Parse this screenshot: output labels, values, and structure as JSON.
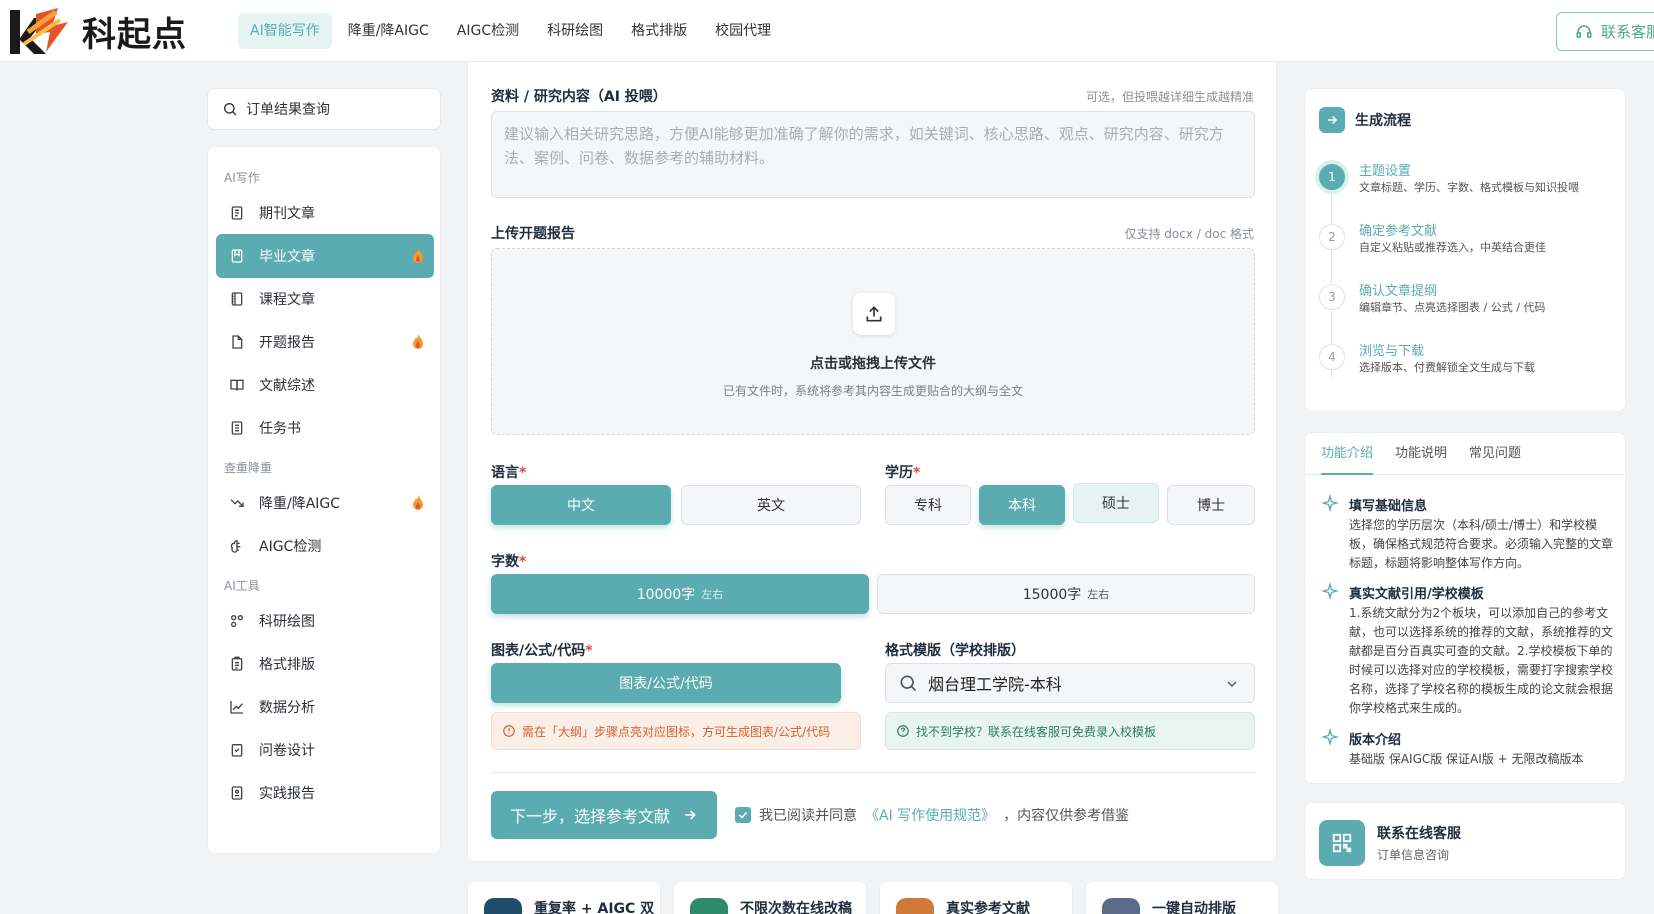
{
  "brand": {
    "name": "科起点"
  },
  "nav": {
    "items": [
      {
        "label": "AI智能写作",
        "active": true
      },
      {
        "label": "降重/降AIGC"
      },
      {
        "label": "AIGC检测"
      },
      {
        "label": "科研绘图"
      },
      {
        "label": "格式排版"
      },
      {
        "label": "校园代理"
      }
    ],
    "contact_label": "联系客服"
  },
  "search": {
    "label": "订单结果查询"
  },
  "sidebar": {
    "groups": [
      {
        "title": "AI写作"
      },
      {
        "title": "查重降重"
      },
      {
        "title": "AI工具"
      }
    ],
    "items": [
      {
        "label": "期刊文章",
        "icon": "document-icon"
      },
      {
        "label": "毕业文章",
        "icon": "book-icon",
        "active": true,
        "hot": true
      },
      {
        "label": "课程文章",
        "icon": "notebook-icon"
      },
      {
        "label": "开题报告",
        "icon": "file-icon",
        "hot": true
      },
      {
        "label": "文献综述",
        "icon": "open-book-icon"
      },
      {
        "label": "任务书",
        "icon": "list-icon"
      },
      {
        "label": "降重/降AIGC",
        "icon": "trend-down-icon",
        "hot": true
      },
      {
        "label": "AIGC检测",
        "icon": "brain-icon"
      },
      {
        "label": "科研绘图",
        "icon": "shapes-icon"
      },
      {
        "label": "格式排版",
        "icon": "clipboard-icon"
      },
      {
        "label": "数据分析",
        "icon": "chart-icon"
      },
      {
        "label": "问卷设计",
        "icon": "checklist-icon"
      },
      {
        "label": "实践报告",
        "icon": "report-icon"
      }
    ]
  },
  "form": {
    "material": {
      "label": "资料 / 研究内容（AI 投喂）",
      "hint": "可选，但投喂越详细生成越精准",
      "placeholder": "建议输入相关研究思路，方便AI能够更加准确了解你的需求，如关键词、核心思路、观点、研究内容、研究方法、案例、问卷、数据参考的辅助材料。"
    },
    "upload": {
      "label": "上传开题报告",
      "hint": "仅支持 docx / doc 格式",
      "title": "点击或拖拽上传文件",
      "sub": "已有文件时，系统将参考其内容生成更贴合的大纲与全文"
    },
    "language": {
      "label": "语言",
      "options": [
        "中文",
        "英文"
      ],
      "selected": "中文"
    },
    "degree": {
      "label": "学历",
      "options": [
        "专科",
        "本科",
        "硕士",
        "博士"
      ],
      "selected": "本科"
    },
    "words": {
      "label": "字数",
      "options": [
        {
          "value": "10000字",
          "note": "左右"
        },
        {
          "value": "15000字",
          "note": "左右"
        }
      ],
      "selected": "10000字"
    },
    "chart": {
      "label": "图表/公式/代码",
      "button": "图表/公式/代码",
      "warn": "需在「大纲」步骤点亮对应图标，方可生成图表/公式/代码"
    },
    "template": {
      "label": "格式模版（学校排版）",
      "value": "烟台理工学院-本科",
      "info": "找不到学校？联系在线客服可免费录入校模板"
    },
    "next_label": "下一步，选择参考文献",
    "agree": {
      "prefix": "我已阅读并同意",
      "link": "《AI 写作使用规范》",
      "suffix": "，内容仅供参考借鉴"
    }
  },
  "features_bottom": [
    {
      "label": "重复率 + AIGC 双",
      "color": "#1f4e6b"
    },
    {
      "label": "不限次数在线改稿",
      "color": "#2f8a6b"
    },
    {
      "label": "真实参考文献",
      "color": "#d07a3a"
    },
    {
      "label": "一键自动排版",
      "color": "#5a6b8a"
    }
  ],
  "flow": {
    "title": "生成流程",
    "steps": [
      {
        "num": "1",
        "title": "主题设置",
        "desc": "文章标题、学历、字数、格式模板与知识投喂"
      },
      {
        "num": "2",
        "title": "确定参考文献",
        "desc": "自定义粘贴或推荐选入，中英结合更佳"
      },
      {
        "num": "3",
        "title": "确认文章提纲",
        "desc": "编辑章节、点亮选择图表 / 公式 / 代码"
      },
      {
        "num": "4",
        "title": "浏览与下载",
        "desc": "选择版本、付费解锁全文生成与下载"
      }
    ]
  },
  "intro": {
    "tabs": [
      "功能介绍",
      "功能说明",
      "常见问题"
    ],
    "items": [
      {
        "title": "填写基础信息",
        "desc": "选择您的学历层次（本科/硕士/博士）和学校模板，确保格式规范符合要求。必须输入完整的文章标题，标题将影响整体写作方向。"
      },
      {
        "title": "真实文献引用/学校模板",
        "desc": "1.系统文献分为2个板块，可以添加自己的参考文献，也可以选择系统的推荐的文献，系统推荐的文献都是百分百真实可查的文献。2.学校模板下单的时候可以选择对应的学校模板，需要打字搜索学校名称，选择了学校名称的模板生成的论文就会根据你学校格式来生成的。"
      },
      {
        "title": "版本介绍",
        "desc": "基础版 保AIGC版 保证AI版 + 无限改稿版本"
      }
    ]
  },
  "support": {
    "title": "联系在线客服",
    "sub": "订单信息咨询"
  }
}
